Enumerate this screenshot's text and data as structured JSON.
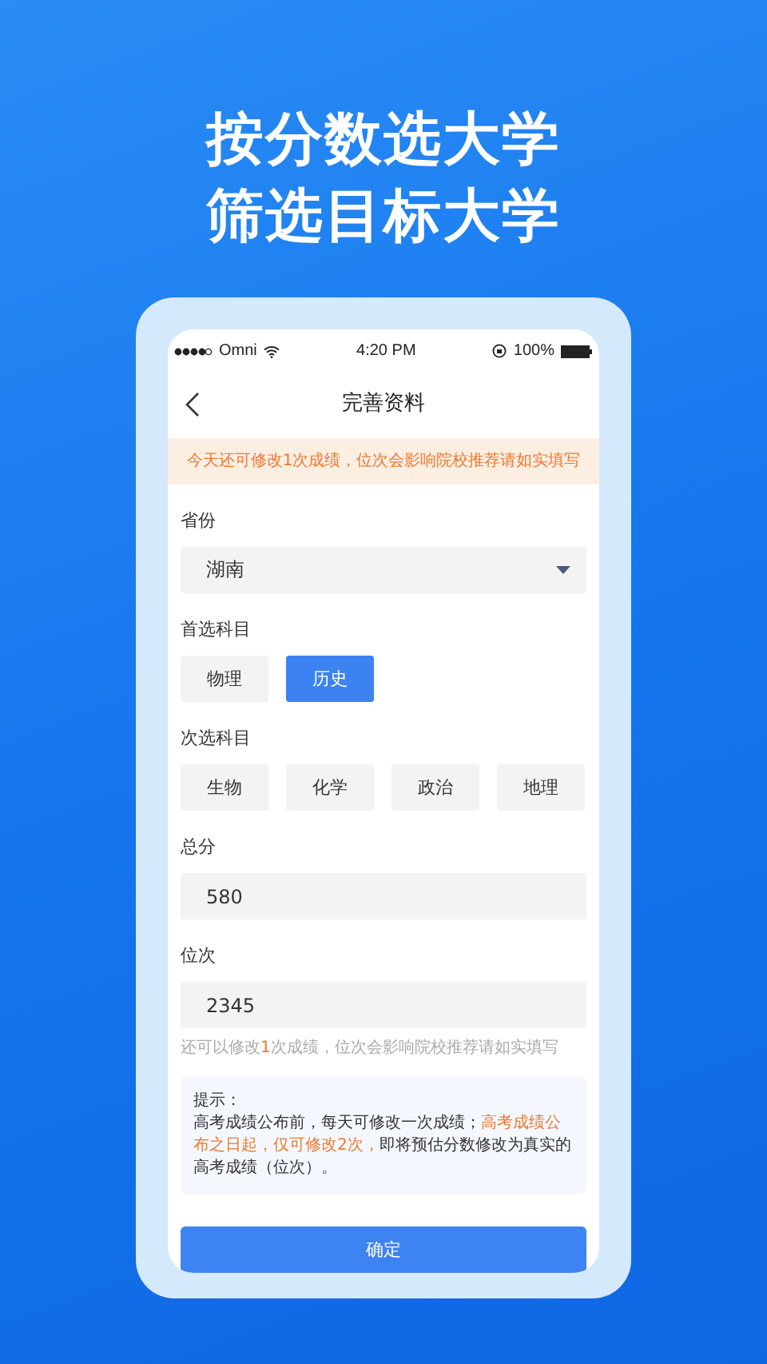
{
  "headline": [
    "按分数选大学",
    "筛选目标大学"
  ],
  "status_bar": {
    "carrier": "Omni",
    "time": "4:20 PM",
    "battery": "100%"
  },
  "nav": {
    "title": "完善资料"
  },
  "notice": "今天还可修改1次成绩，位次会影响院校推荐请如实填写",
  "province": {
    "label": "省份",
    "value": "湖南"
  },
  "first_subject": {
    "label": "首选科目",
    "options": [
      {
        "label": "物理",
        "selected": false
      },
      {
        "label": "历史",
        "selected": true
      }
    ]
  },
  "second_subject": {
    "label": "次选科目",
    "options": [
      {
        "label": "生物",
        "selected": false
      },
      {
        "label": "化学",
        "selected": false
      },
      {
        "label": "政治",
        "selected": false
      },
      {
        "label": "地理",
        "selected": false
      }
    ]
  },
  "score": {
    "label": "总分",
    "value": "580"
  },
  "rank": {
    "label": "位次",
    "value": "2345"
  },
  "hint": [
    {
      "text": "还可以修改",
      "highlight": false
    },
    {
      "text": "1",
      "highlight": true
    },
    {
      "text": "次成绩，位次会影响院校推荐请如实填写",
      "highlight": false
    }
  ],
  "tip": {
    "title": "提示：",
    "segments": [
      {
        "text": "高考成绩公布前，每天可修改一次成绩；",
        "highlight": false
      },
      {
        "text": "高考成绩公布之日起，仅可修改2次，",
        "highlight": true
      },
      {
        "text": "即将预估分数修改为真实的高考成绩（位次）。",
        "highlight": false
      }
    ]
  },
  "confirm_button": "确定"
}
